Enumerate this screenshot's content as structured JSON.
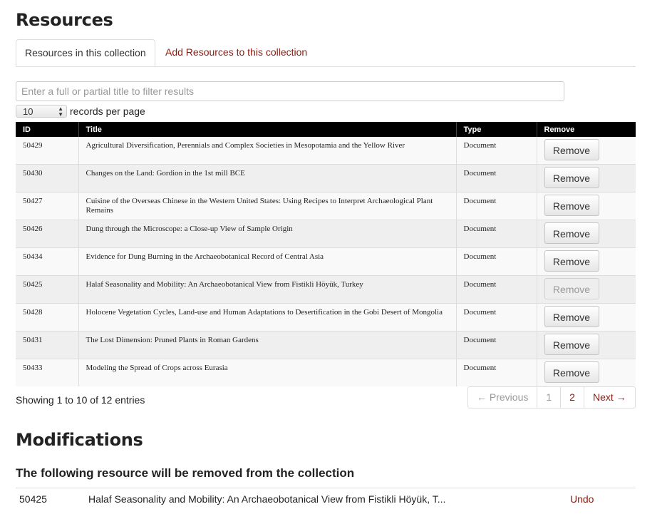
{
  "resources_title": "Resources",
  "tabs": [
    {
      "label": "Resources in this collection",
      "active": true
    },
    {
      "label": "Add Resources to this collection",
      "active": false
    }
  ],
  "filter": {
    "placeholder": "Enter a full or partial title to filter results",
    "value": ""
  },
  "per_page": {
    "value": "10",
    "label": "records per page"
  },
  "table": {
    "headers": [
      "ID",
      "Title",
      "Type",
      "Remove"
    ],
    "rows": [
      {
        "id": "50429",
        "title": "Agricultural Diversification, Perennials and Complex Societies in Mesopotamia and the Yellow River",
        "type": "Document",
        "button": "Remove",
        "disabled": false
      },
      {
        "id": "50430",
        "title": "Changes on the Land: Gordion in the 1st mill BCE",
        "type": "Document",
        "button": "Remove",
        "disabled": false
      },
      {
        "id": "50427",
        "title": "Cuisine of the Overseas Chinese in the Western United States: Using Recipes to Interpret Archaeological Plant Remains",
        "type": "Document",
        "button": "Remove",
        "disabled": false
      },
      {
        "id": "50426",
        "title": "Dung through the Microscope: a Close-up View of Sample Origin",
        "type": "Document",
        "button": "Remove",
        "disabled": false
      },
      {
        "id": "50434",
        "title": "Evidence for Dung Burning in the Archaeobotanical Record of Central Asia",
        "type": "Document",
        "button": "Remove",
        "disabled": false
      },
      {
        "id": "50425",
        "title": "Halaf Seasonality and Mobility: An Archaeobotanical View from Fistikli Höyük, Turkey",
        "type": "Document",
        "button": "Remove",
        "disabled": true
      },
      {
        "id": "50428",
        "title": "Holocene Vegetation Cycles, Land-use and Human Adaptations to Desertification in the Gobi Desert of Mongolia",
        "type": "Document",
        "button": "Remove",
        "disabled": false
      },
      {
        "id": "50431",
        "title": "The Lost Dimension: Pruned Plants in Roman Gardens",
        "type": "Document",
        "button": "Remove",
        "disabled": false
      },
      {
        "id": "50433",
        "title": "Modeling the Spread of Crops across Eurasia",
        "type": "Document",
        "button": "Remove",
        "disabled": false
      }
    ]
  },
  "entries_info": "Showing 1 to 10 of 12 entries",
  "pagination": {
    "previous": "← Previous",
    "pages": [
      "1",
      "2"
    ],
    "next": "Next →"
  },
  "modifications_title": "Modifications",
  "modifications_subtitle": "The following resource will be removed from the collection",
  "modification": {
    "id": "50425",
    "title": "Halaf Seasonality and Mobility: An Archaeobotanical View from Fistikli Höyük, T...",
    "undo": "Undo"
  },
  "colors": {
    "link": "#8b1a10",
    "header_bg": "#000000"
  }
}
